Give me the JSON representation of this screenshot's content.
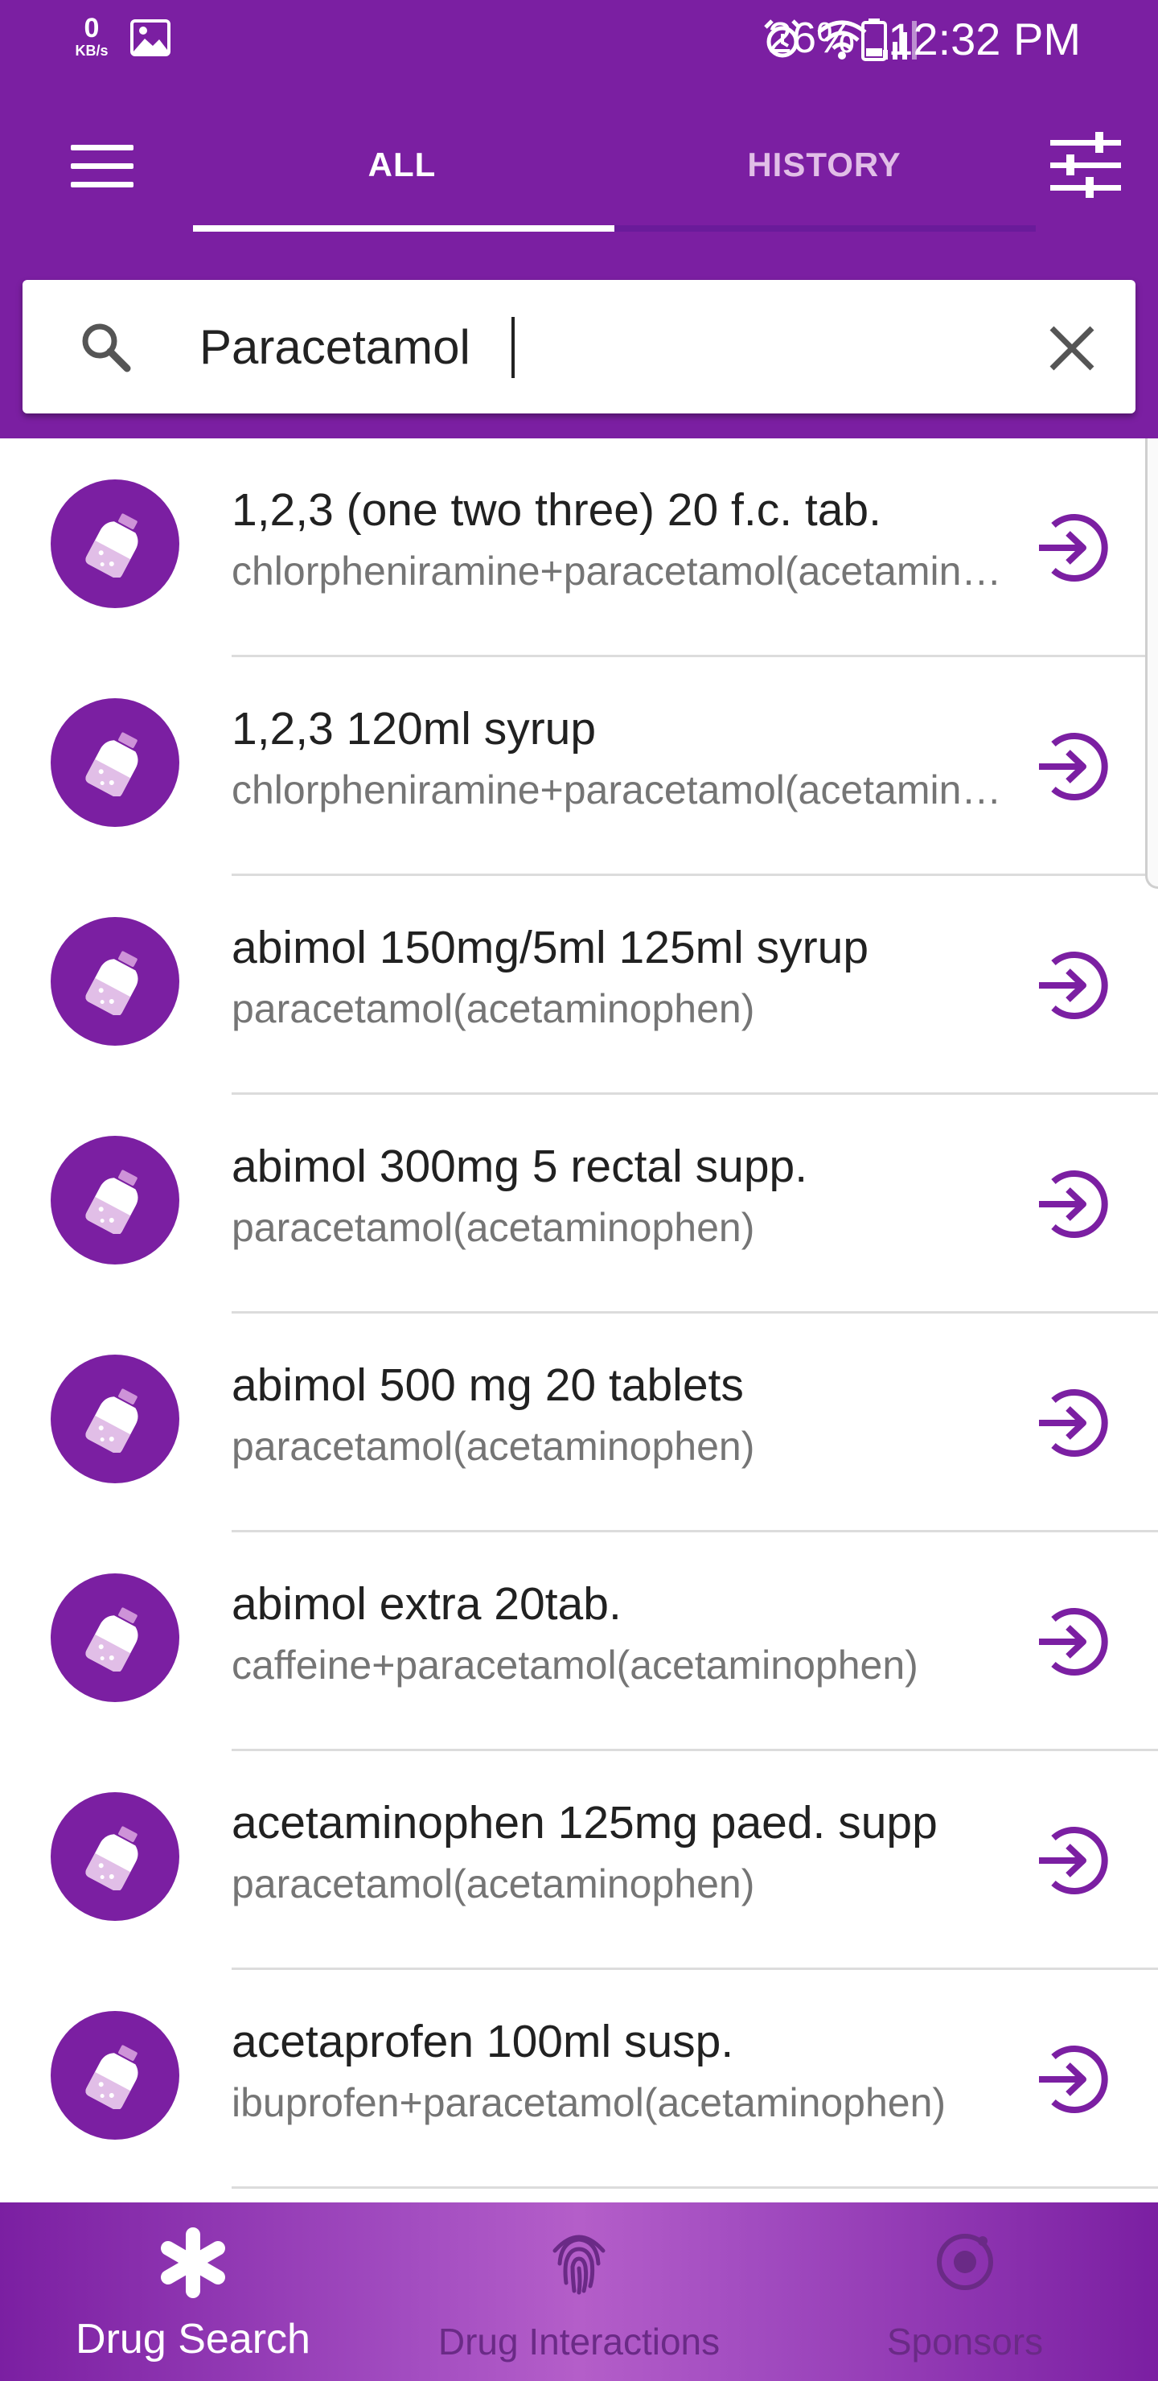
{
  "status_bar": {
    "kbs_value": "0",
    "kbs_unit": "KB/s",
    "battery": "26%",
    "time": "12:32 PM"
  },
  "tabs": [
    {
      "label": "ALL",
      "active": true
    },
    {
      "label": "HISTORY",
      "active": false
    }
  ],
  "search": {
    "value": "Paracetamol",
    "placeholder": ""
  },
  "results": [
    {
      "title": "1,2,3 (one two three) 20 f.c. tab.",
      "subtitle": "chlorpheniramine+paracetamol(acetaminophen)"
    },
    {
      "title": "1,2,3 120ml syrup",
      "subtitle": "chlorpheniramine+paracetamol(acetaminophen)"
    },
    {
      "title": "abimol 150mg/5ml 125ml syrup",
      "subtitle": "paracetamol(acetaminophen)"
    },
    {
      "title": "abimol 300mg 5 rectal supp.",
      "subtitle": "paracetamol(acetaminophen)"
    },
    {
      "title": "abimol 500 mg 20 tablets",
      "subtitle": "paracetamol(acetaminophen)"
    },
    {
      "title": "abimol extra 20tab.",
      "subtitle": "caffeine+paracetamol(acetaminophen)"
    },
    {
      "title": "acetaminophen 125mg paed. supp",
      "subtitle": "paracetamol(acetaminophen)"
    },
    {
      "title": "acetaprofen 100ml susp.",
      "subtitle": "ibuprofen+paracetamol(acetaminophen)"
    }
  ],
  "bottom_nav": [
    {
      "label": "Drug Search",
      "icon": "asterisk-icon",
      "active": true
    },
    {
      "label": "Drug Interactions",
      "icon": "fingerprint-icon",
      "active": false
    },
    {
      "label": "Sponsors",
      "icon": "target-icon",
      "active": false
    }
  ],
  "colors": {
    "primary": "#7b1fa2",
    "divider": "#dcdcdc",
    "title_text": "#212121",
    "subtitle_text": "#757575"
  }
}
